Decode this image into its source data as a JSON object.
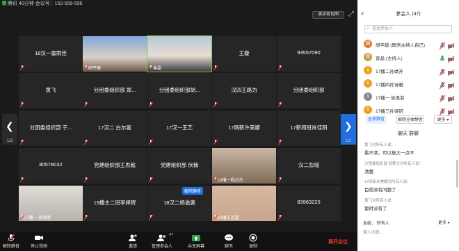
{
  "topbar": {
    "text": "腾讯 40分钟 会议号：152-569-596"
  },
  "view_btn": "演讲者视图",
  "tiles": [
    {
      "name": "18汉一雷雨佳",
      "sub": ""
    },
    {
      "name": "",
      "sub": "阿平建"
    },
    {
      "name": "",
      "sub": "曾晶"
    },
    {
      "name": "王璇",
      "sub": ""
    },
    {
      "name": "93557090",
      "sub": ""
    },
    {
      "name": "黄飞",
      "sub": ""
    },
    {
      "name": "分团委组织部 郑...",
      "sub": ""
    },
    {
      "name": "分团委组织部胡...",
      "sub": ""
    },
    {
      "name": "汉四王路为",
      "sub": ""
    },
    {
      "name": "分团委组织部",
      "sub": ""
    },
    {
      "name": "分团委组织部 于...",
      "sub": ""
    },
    {
      "name": "17汉二 白尔嘉",
      "sub": ""
    },
    {
      "name": "17汉一王艺",
      "sub": ""
    },
    {
      "name": "17网新许美娜",
      "sub": ""
    },
    {
      "name": "17新闻班肖佳阳",
      "sub": ""
    },
    {
      "name": "80578032",
      "sub": ""
    },
    {
      "name": "党建组织部王思懿",
      "sub": ""
    },
    {
      "name": "党建组织部 伏楠",
      "sub": ""
    },
    {
      "name": "",
      "sub": "18播一杨贞杰"
    },
    {
      "name": "汉二彭瑶",
      "sub": ""
    },
    {
      "name": "",
      "sub": "17播一 侯逸菲"
    },
    {
      "name": "19播主二班李婷辉",
      "sub": ""
    },
    {
      "name": "18汉二杨滋惠",
      "sub": ""
    },
    {
      "name": "",
      "sub": "18播王艺嘉"
    },
    {
      "name": "83963225",
      "sub": ""
    }
  ],
  "unmute_badge": "解除静音",
  "page_indicator": "1/2",
  "toolbar": {
    "unmute": "解除静音",
    "stop_video": "停止视频",
    "invite": "邀请",
    "manage": "管理参会人",
    "manage_count": "47",
    "share": "共享屏幕",
    "chat": "聊天",
    "record": "录制",
    "end": "离开会议"
  },
  "panel": {
    "title": "参会人 (47)",
    "search_placeholder": "查找参会人",
    "participants": [
      {
        "avatar": "胡",
        "name": "胡平建 (联席主持人自己)",
        "color": "#e07b39"
      },
      {
        "avatar": "曾",
        "name": "曾晶 (主持人)",
        "color": "#c69b3c"
      },
      {
        "avatar": "1",
        "name": "17播二孙靖开",
        "color": "#f0a020"
      },
      {
        "avatar": "1",
        "name": "17播四孙诗雅",
        "color": "#f0a020"
      },
      {
        "avatar": "1",
        "name": "17播一 侯逸菲",
        "color": "#8a8a8a"
      },
      {
        "avatar": "1",
        "name": "17播三孙诗研",
        "color": "#f0a020"
      }
    ],
    "btn_mute_all": "全体静音",
    "btn_unmute_all": "解除全体静音",
    "btn_more": "更多"
  },
  "chat": {
    "title": "聊天 群聊",
    "messages": [
      {
        "from": "黄飞对所有人说：",
        "text": "看不清，可以放大一点不"
      },
      {
        "from": "分团委组织部 郑楚文对所有人说：",
        "text": "清楚"
      },
      {
        "from": "17网新许美娜对所有人说：",
        "text": "目前没有问题了"
      },
      {
        "from": "黄飞对所有人说：",
        "text": "暂时没有了"
      }
    ],
    "send_to_label": "发给：",
    "send_to_value": "所有人",
    "more": "更多",
    "input_placeholder": "输入消息..."
  }
}
